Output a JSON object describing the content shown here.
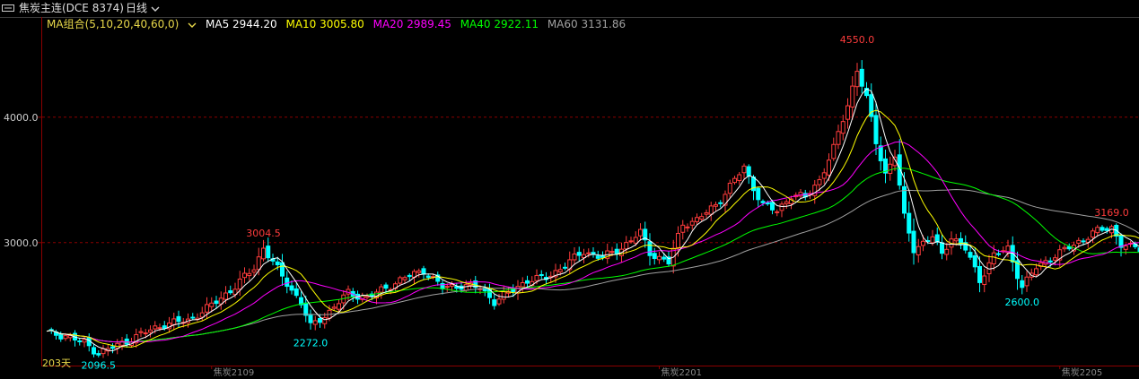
{
  "titlebar": {
    "symbol": "焦炭主连(DCE 8374)",
    "period": "日线",
    "period_arrow": "chevron-down-icon"
  },
  "legend": {
    "combo": "MA组合(5,10,20,40,60,0)",
    "ma5": "MA5 2944.20",
    "ma10": "MA10 3005.80",
    "ma20": "MA20 2989.45",
    "ma40": "MA40 2922.11",
    "ma60": "MA60 3131.86"
  },
  "colors": {
    "up": "#ff3c3c",
    "down": "#00ffff",
    "ma5": "#ffffff",
    "ma10": "#ffff00",
    "ma20": "#ff00ff",
    "ma40": "#00ff00",
    "ma60": "#a0a0a0",
    "grid": "#8b0000",
    "label_high": "#ff3c3c",
    "label_low": "#00ffff"
  },
  "chart_data": {
    "type": "candlestick",
    "y_ticks": [
      "4000.0",
      "3000.0"
    ],
    "ylim": [
      2020,
      4720
    ],
    "x_labels": [
      {
        "i": 35,
        "text": "焦炭2109"
      },
      {
        "i": 130,
        "text": "焦炭2201"
      },
      {
        "i": 215,
        "text": "焦炭2205"
      }
    ],
    "bar_count_label": "203天",
    "annotations": [
      {
        "text": "4550.0",
        "value": 4550,
        "kind": "high",
        "i": 172
      },
      {
        "text": "3004.5",
        "value": 3004.5,
        "kind": "high",
        "i": 46
      },
      {
        "text": "3169.0",
        "value": 3169,
        "kind": "high",
        "i": 226
      },
      {
        "text": "2096.5",
        "value": 2096.5,
        "kind": "low",
        "i": 11
      },
      {
        "text": "2272.0",
        "value": 2272,
        "kind": "low",
        "i": 56
      },
      {
        "text": "2600.0",
        "value": 2600,
        "kind": "low",
        "i": 207
      }
    ],
    "close_anchors": [
      [
        0,
        2280
      ],
      [
        4,
        2260
      ],
      [
        8,
        2200
      ],
      [
        11,
        2120
      ],
      [
        15,
        2180
      ],
      [
        20,
        2270
      ],
      [
        25,
        2350
      ],
      [
        30,
        2380
      ],
      [
        35,
        2500
      ],
      [
        40,
        2650
      ],
      [
        44,
        2800
      ],
      [
        46,
        2960
      ],
      [
        50,
        2730
      ],
      [
        54,
        2520
      ],
      [
        56,
        2330
      ],
      [
        60,
        2450
      ],
      [
        64,
        2600
      ],
      [
        68,
        2560
      ],
      [
        72,
        2640
      ],
      [
        76,
        2720
      ],
      [
        80,
        2780
      ],
      [
        84,
        2640
      ],
      [
        88,
        2660
      ],
      [
        92,
        2640
      ],
      [
        95,
        2530
      ],
      [
        98,
        2600
      ],
      [
        102,
        2700
      ],
      [
        106,
        2720
      ],
      [
        110,
        2820
      ],
      [
        114,
        2930
      ],
      [
        118,
        2880
      ],
      [
        122,
        2960
      ],
      [
        126,
        3080
      ],
      [
        128,
        2920
      ],
      [
        132,
        2840
      ],
      [
        135,
        3150
      ],
      [
        138,
        3180
      ],
      [
        142,
        3300
      ],
      [
        146,
        3500
      ],
      [
        148,
        3600
      ],
      [
        150,
        3440
      ],
      [
        152,
        3300
      ],
      [
        155,
        3250
      ],
      [
        158,
        3380
      ],
      [
        161,
        3360
      ],
      [
        164,
        3500
      ],
      [
        167,
        3750
      ],
      [
        170,
        4100
      ],
      [
        172,
        4380
      ],
      [
        174,
        4150
      ],
      [
        176,
        3800
      ],
      [
        178,
        3550
      ],
      [
        180,
        3700
      ],
      [
        182,
        3200
      ],
      [
        184,
        2950
      ],
      [
        186,
        3000
      ],
      [
        188,
        3050
      ],
      [
        190,
        2900
      ],
      [
        192,
        3050
      ],
      [
        195,
        2950
      ],
      [
        198,
        2700
      ],
      [
        201,
        2900
      ],
      [
        204,
        2950
      ],
      [
        207,
        2650
      ],
      [
        210,
        2800
      ],
      [
        214,
        2900
      ],
      [
        218,
        2980
      ],
      [
        222,
        3080
      ],
      [
        226,
        3120
      ],
      [
        228,
        2990
      ],
      [
        230,
        2960
      ],
      [
        232,
        2950
      ],
      [
        233,
        3000
      ]
    ]
  }
}
